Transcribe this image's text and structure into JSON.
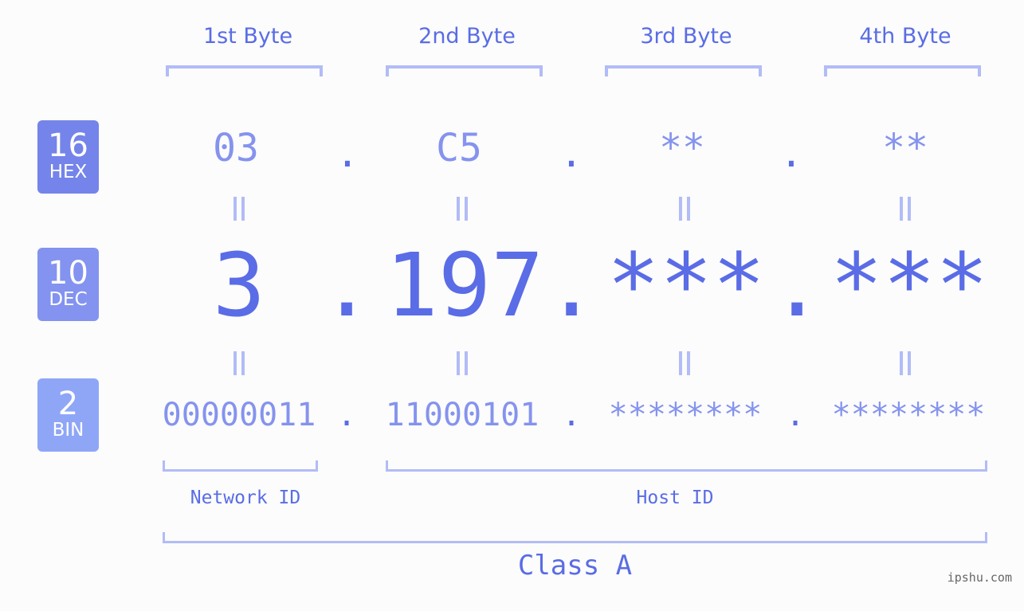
{
  "bytes": [
    {
      "label": "1st Byte",
      "hex": "03",
      "dec": "3",
      "bin": "00000011"
    },
    {
      "label": "2nd Byte",
      "hex": "C5",
      "dec": "197",
      "bin": "11000101"
    },
    {
      "label": "3rd Byte",
      "hex": "**",
      "dec": "***",
      "bin": "********"
    },
    {
      "label": "4th Byte",
      "hex": "**",
      "dec": "***",
      "bin": "********"
    }
  ],
  "separator": ".",
  "badges": {
    "hex": {
      "num": "16",
      "name": "HEX",
      "color": "#7484ea"
    },
    "dec": {
      "num": "10",
      "name": "DEC",
      "color": "#8393ef"
    },
    "bin": {
      "num": "2",
      "name": "BIN",
      "color": "#8fa6f7"
    }
  },
  "ids": {
    "network": "Network ID",
    "host": "Host ID"
  },
  "class_label": "Class A",
  "watermark": "ipshu.com",
  "colors": {
    "accent": "#5a6ce6",
    "light_value": "#8593ee",
    "bracket": "#b2bcf7",
    "background": "#fbfcfb"
  }
}
